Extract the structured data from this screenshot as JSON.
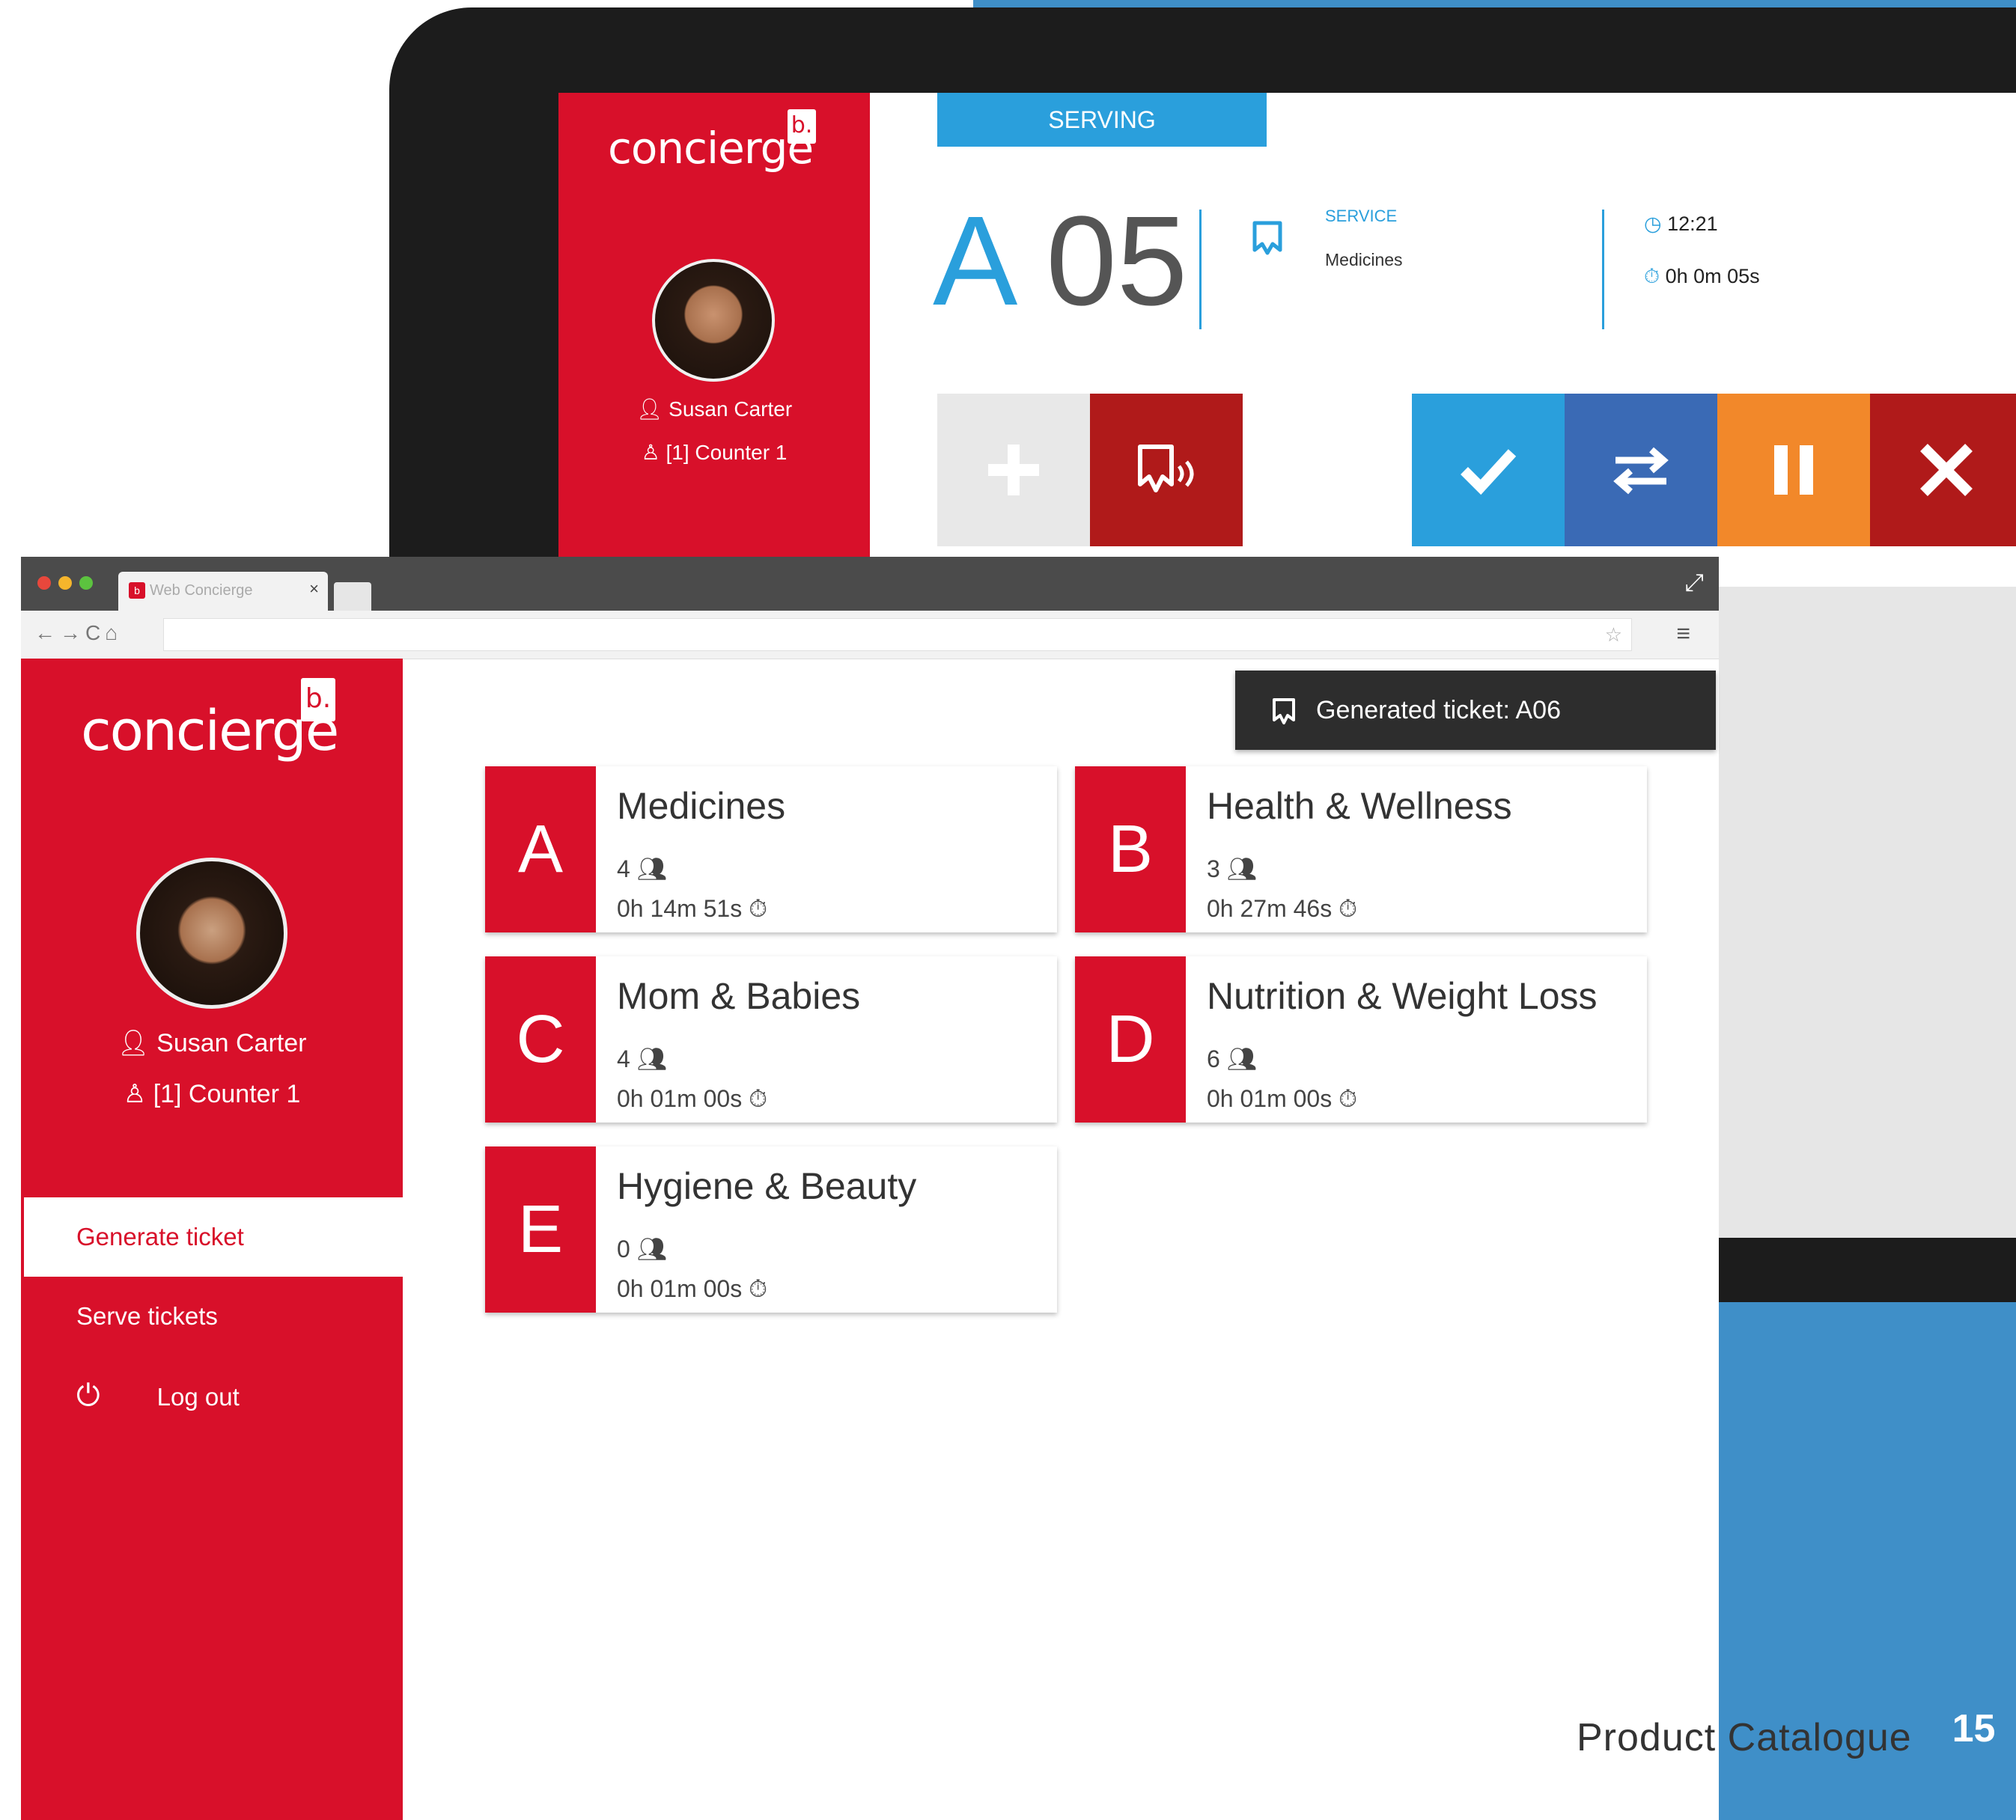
{
  "colors": {
    "brand_red": "#d8102a",
    "blue": "#2a9fdc",
    "dark_blue": "#3a6ab5",
    "orange": "#f2882a",
    "dark_red": "#b01a1a",
    "grey_tile": "#e8e8e8"
  },
  "back_app": {
    "logo": "concierge",
    "logo_badge": "b.",
    "user": "Susan Carter",
    "counter": "[1] Counter 1",
    "serving_tab": "SERVING",
    "ticket_letter": "A",
    "ticket_number": "05",
    "service_label": "SERVICE",
    "service_name": "Medicines",
    "clock_time": "12:21",
    "elapsed": "0h 0m 05s",
    "action_icons": [
      "add-icon",
      "call-again-icon",
      "check-icon",
      "transfer-icon",
      "pause-icon",
      "close-icon"
    ]
  },
  "browser": {
    "tab_title": "Web Concierge",
    "tab_close": "×"
  },
  "app": {
    "logo": "concierge",
    "logo_badge": "b.",
    "user": "Susan Carter",
    "counter": "[1] Counter 1",
    "menu": {
      "generate": "Generate ticket",
      "serve": "Serve tickets",
      "logout": "Log out"
    },
    "toast": "Generated ticket: A06",
    "services": [
      {
        "letter": "A",
        "name": "Medicines",
        "count": "4",
        "time": "0h 14m 51s"
      },
      {
        "letter": "B",
        "name": "Health & Wellness",
        "count": "3",
        "time": "0h 27m 46s"
      },
      {
        "letter": "C",
        "name": "Mom & Babies",
        "count": "4",
        "time": "0h 01m 00s"
      },
      {
        "letter": "D",
        "name": "Nutrition & Weight Loss",
        "count": "6",
        "time": "0h 01m 00s"
      },
      {
        "letter": "E",
        "name": "Hygiene & Beauty",
        "count": "0",
        "time": "0h 01m 00s"
      }
    ]
  },
  "footer": {
    "text": "Product Catalogue",
    "page": "15"
  }
}
